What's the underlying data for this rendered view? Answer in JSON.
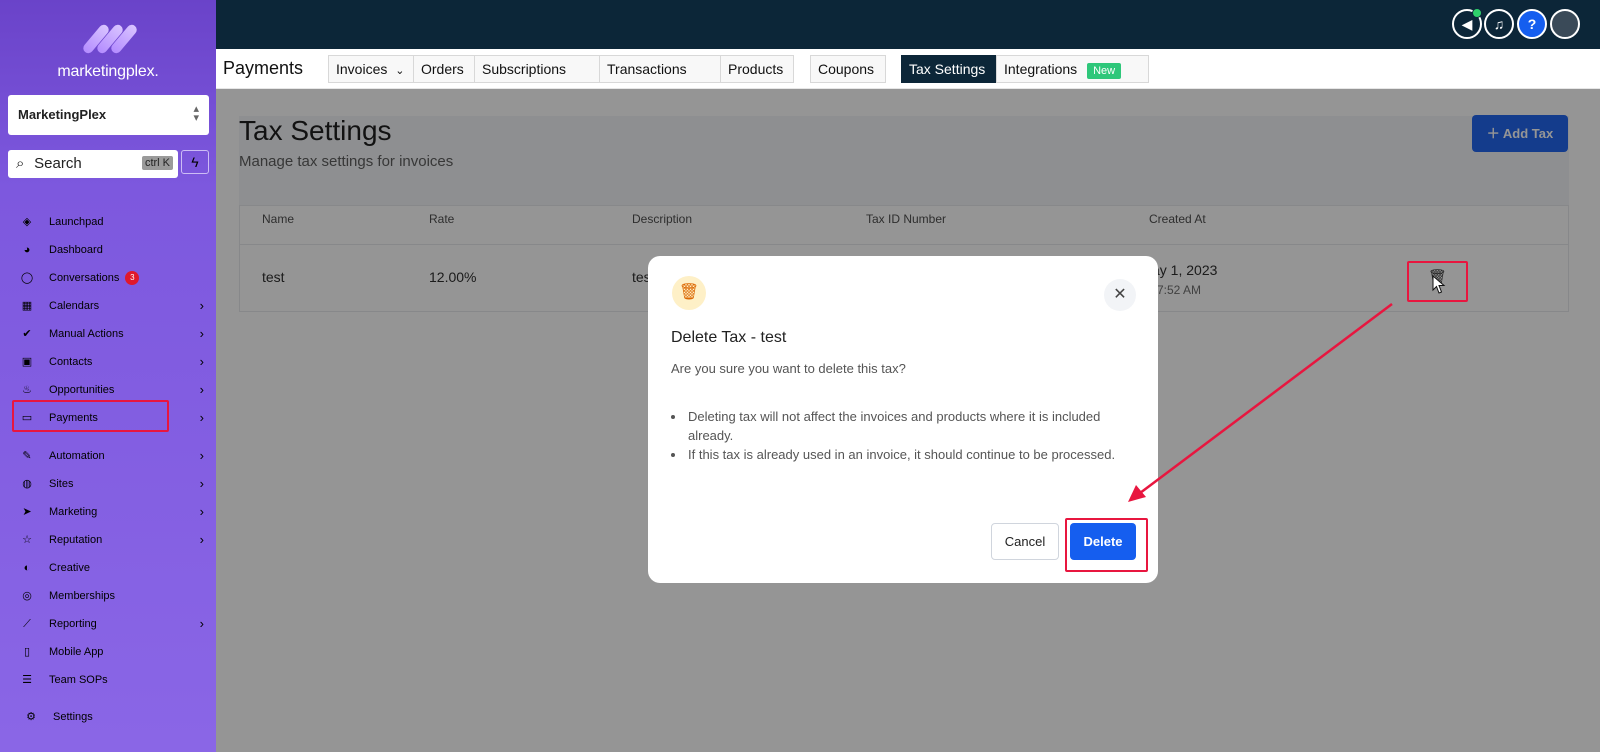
{
  "brand": {
    "name": "marketingplex."
  },
  "account": {
    "name": "MarketingPlex"
  },
  "search": {
    "label": "Search",
    "shortcut": "ctrl K"
  },
  "sidebar": {
    "items": [
      {
        "label": "Launchpad",
        "icon": "rocket-icon"
      },
      {
        "label": "Dashboard",
        "icon": "gauge-icon"
      },
      {
        "label": "Conversations",
        "icon": "chat-icon",
        "badge": "3"
      },
      {
        "label": "Calendars",
        "icon": "calendar-icon"
      },
      {
        "label": "Manual Actions",
        "icon": "check-circle-icon"
      },
      {
        "label": "Contacts",
        "icon": "contact-card-icon"
      },
      {
        "label": "Opportunities",
        "icon": "flame-icon"
      },
      {
        "label": "Payments",
        "icon": "credit-card-icon"
      },
      {
        "label": "Automation",
        "icon": "magic-wand-icon"
      },
      {
        "label": "Sites",
        "icon": "globe-icon"
      },
      {
        "label": "Marketing",
        "icon": "paper-plane-icon"
      },
      {
        "label": "Reputation",
        "icon": "star-icon"
      },
      {
        "label": "Creative",
        "icon": "palette-icon"
      },
      {
        "label": "Memberships",
        "icon": "award-icon"
      },
      {
        "label": "Reporting",
        "icon": "chart-icon"
      },
      {
        "label": "Mobile App",
        "icon": "phone-icon"
      },
      {
        "label": "Team SOPs",
        "icon": "list-icon"
      }
    ],
    "settings": "Settings"
  },
  "tabbar": {
    "title": "Payments",
    "tabs": [
      "Invoices",
      "Orders",
      "Subscriptions",
      "Transactions",
      "Products",
      "Coupons",
      "Tax Settings",
      "Integrations"
    ],
    "new_badge": "New"
  },
  "page": {
    "title": "Tax Settings",
    "subtitle": "Manage tax settings for invoices",
    "add_button": "Add Tax"
  },
  "table": {
    "headers": [
      "Name",
      "Rate",
      "Description",
      "Tax ID Number",
      "Created At"
    ],
    "row": {
      "name": "test",
      "rate": "12.00%",
      "description": "tes",
      "created_date": "ay 1, 2023",
      "created_time": "7:52 AM"
    }
  },
  "modal": {
    "title": "Delete Tax - test",
    "question": "Are you sure you want to delete this tax?",
    "bullets": [
      "Deleting tax will not affect the invoices and products where it is included already.",
      "If this tax is already used in an invoice, it should continue to be processed."
    ],
    "cancel": "Cancel",
    "delete": "Delete"
  },
  "colors": {
    "accent": "#155eef",
    "sidebar": "#7d58de",
    "topbar": "#0c2638",
    "highlight": "#e8163f"
  }
}
